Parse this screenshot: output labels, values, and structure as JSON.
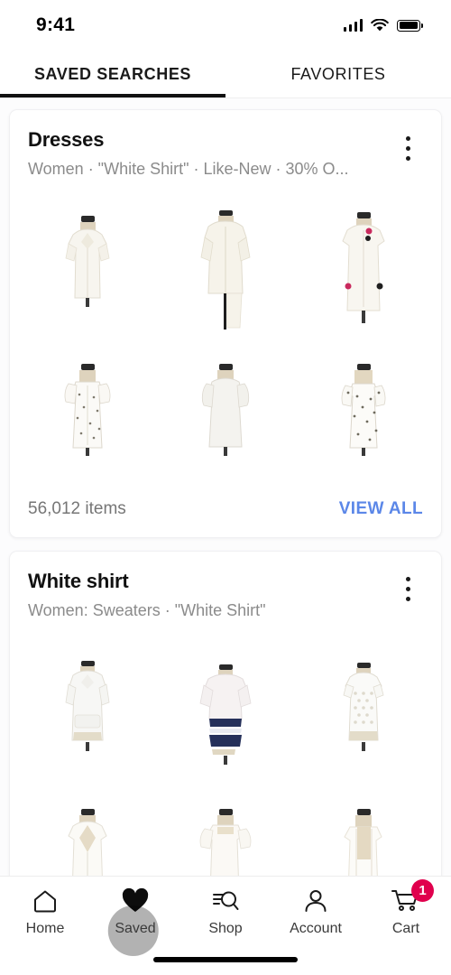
{
  "status_bar": {
    "time": "9:41",
    "signal_icon": "cellular-signal-icon",
    "wifi_icon": "wifi-icon",
    "battery_icon": "battery-full-icon"
  },
  "tabs": [
    {
      "label": "SAVED SEARCHES",
      "active": true
    },
    {
      "label": "FAVORITES",
      "active": false
    }
  ],
  "cards": [
    {
      "title": "Dresses",
      "subtitle": "Women · \"White Shirt\" · Like-New · 30% O...",
      "menu_icon": "kebab-menu-icon",
      "items_count": "56,012 items",
      "view_all_label": "VIEW ALL",
      "products": [
        {
          "name": "white-short-sleeve-button-shirt",
          "kind": "shirt-short",
          "body": "#f7f5ef",
          "accent": "#e9e5da"
        },
        {
          "name": "cream-long-blouse",
          "kind": "blouse-long",
          "body": "#f6f3ea",
          "accent": "#e6e1d4"
        },
        {
          "name": "ivory-tunic-with-pins",
          "kind": "tunic",
          "body": "#f8f6f0",
          "accent": "#e8e3d8"
        },
        {
          "name": "white-floral-mini-dress",
          "kind": "dress-floral",
          "body": "#fbfaf7",
          "accent": "#dedad0"
        },
        {
          "name": "white-puff-sleeve-dress",
          "kind": "dress-plain",
          "body": "#f4f3ef",
          "accent": "#e2dfd7"
        },
        {
          "name": "white-printed-square-neck-dress",
          "kind": "dress-floral",
          "body": "#fcfbf8",
          "accent": "#dcd7cc"
        }
      ]
    },
    {
      "title": "White shirt",
      "subtitle": "Women: Sweaters · \"White Shirt\"",
      "menu_icon": "kebab-menu-icon",
      "items_count": "",
      "view_all_label": "",
      "products": [
        {
          "name": "white-v-neck-sweater",
          "kind": "sweater-v",
          "body": "#f7f7f5",
          "accent": "#e3e0d6"
        },
        {
          "name": "navy-tie-dye-top",
          "kind": "tiedye",
          "body": "#f6f2f2",
          "accent": "#25305a"
        },
        {
          "name": "white-eyelet-knit-top",
          "kind": "knit-top",
          "body": "#fafaf8",
          "accent": "#e0dcd1"
        },
        {
          "name": "white-cardigan",
          "kind": "cardigan",
          "body": "#fbfaf6",
          "accent": "#e6e2d8"
        },
        {
          "name": "white-ruffle-sleeve-top",
          "kind": "ruffle-top",
          "body": "#fbf9f5",
          "accent": "#e6e1d6"
        },
        {
          "name": "white-open-front-jacket",
          "kind": "jacket",
          "body": "#fcfbf8",
          "accent": "#e8e3d7"
        }
      ]
    }
  ],
  "bottom_nav": [
    {
      "label": "Home",
      "icon": "home-icon",
      "active": false,
      "badge": ""
    },
    {
      "label": "Saved",
      "icon": "heart-filled-icon",
      "active": true,
      "badge": ""
    },
    {
      "label": "Shop",
      "icon": "search-filter-icon",
      "active": false,
      "badge": ""
    },
    {
      "label": "Account",
      "icon": "person-icon",
      "active": false,
      "badge": ""
    },
    {
      "label": "Cart",
      "icon": "shopping-cart-icon",
      "active": false,
      "badge": "1"
    }
  ],
  "colors": {
    "accent_blue": "#5b87e8",
    "badge_red": "#e0004d",
    "text_primary": "#111111",
    "text_secondary": "#8b8b8b",
    "page_bg": "#fcfcfd"
  }
}
